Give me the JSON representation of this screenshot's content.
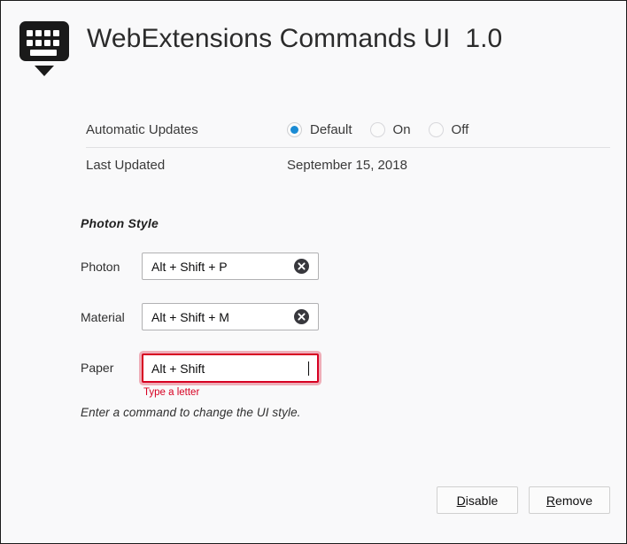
{
  "window": {
    "background_color": "#f9f9fa",
    "border_color": "#1b1b1b"
  },
  "header": {
    "icon_name": "keyboard-with-down-arrow-icon",
    "title": "WebExtensions Commands UI  1.0"
  },
  "details": {
    "rows": [
      {
        "label": "Automatic Updates",
        "type": "radio-group",
        "options": [
          {
            "label": "Default",
            "selected": true
          },
          {
            "label": "On",
            "selected": false
          },
          {
            "label": "Off",
            "selected": false
          }
        ]
      },
      {
        "label": "Last Updated",
        "type": "text",
        "value": "September 15, 2018"
      }
    ]
  },
  "commands": {
    "section_title": "Photon Style",
    "shortcuts": [
      {
        "label": "Photon",
        "value": "Alt + Shift + P",
        "has_clear": true,
        "invalid": false,
        "error": "",
        "focused": false
      },
      {
        "label": "Material",
        "value": "Alt + Shift + M",
        "has_clear": true,
        "invalid": false,
        "error": "",
        "focused": false
      },
      {
        "label": "Paper",
        "value": "Alt + Shift",
        "has_clear": false,
        "invalid": true,
        "error": "Type a letter",
        "focused": true
      }
    ],
    "note": "Enter a command to change the UI style."
  },
  "footer": {
    "buttons": [
      {
        "accel": "D",
        "rest": "isable"
      },
      {
        "accel": "R",
        "rest": "emove"
      }
    ]
  },
  "colors": {
    "accent_blue": "#1a8bd4",
    "error_red": "#d70022",
    "text": "#3a3a3a"
  }
}
